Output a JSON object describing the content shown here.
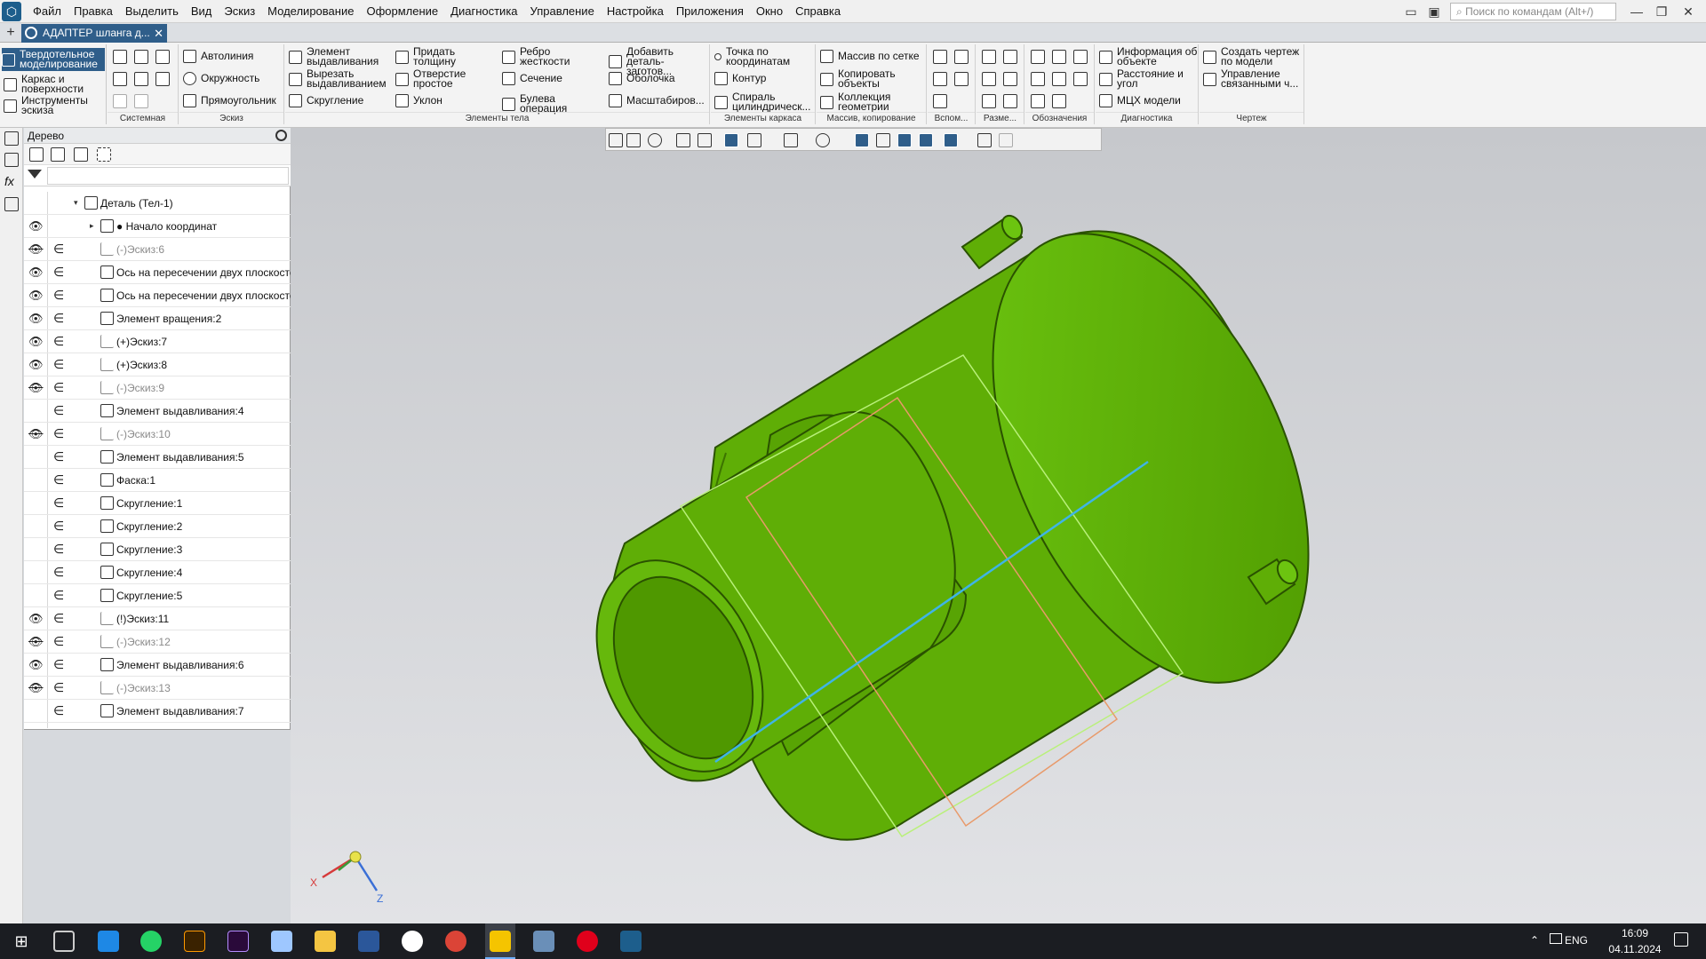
{
  "menubar": {
    "items": [
      "Файл",
      "Правка",
      "Выделить",
      "Вид",
      "Эскиз",
      "Моделирование",
      "Оформление",
      "Диагностика",
      "Управление",
      "Настройка",
      "Приложения",
      "Окно",
      "Справка"
    ],
    "search_placeholder": "Поиск по командам (Alt+/)"
  },
  "tabs": {
    "document_title": "АДАПТЕР шланга д..."
  },
  "ribbon": {
    "modes": [
      "Твердотельное моделирование",
      "Каркас и поверхности",
      "Инструменты эскиза"
    ],
    "groups": {
      "system": "Системная",
      "sketch": "Эскиз",
      "body": "Элементы тела",
      "frame": "Элементы каркаса",
      "array": "Массив, копирование",
      "aux": "Вспом...",
      "dims": "Разме...",
      "marks": "Обозначения",
      "diag": "Диагностика",
      "drawing": "Чертеж"
    },
    "sketch_tools": [
      "Автолиния",
      "Окружность",
      "Прямоугольник"
    ],
    "body_tools": [
      "Элемент выдавливания",
      "Вырезать выдавливанием",
      "Скругление",
      "Придать толщину",
      "Отверстие простое",
      "Уклон",
      "Ребро жесткости",
      "Сечение",
      "Булева операция",
      "Добавить деталь-заготов...",
      "Оболочка",
      "Масштабиров..."
    ],
    "frame_tools": [
      "Точка по координатам",
      "Контур",
      "Спираль цилиндрическ..."
    ],
    "array_tools": [
      "Массив по сетке",
      "Копировать объекты",
      "Коллекция геометрии"
    ],
    "diag_tools": [
      "Информация об объекте",
      "Расстояние и угол",
      "МЦХ модели"
    ],
    "drawing_tools": [
      "Создать чертеж по модели",
      "Управление связанными ч..."
    ]
  },
  "tree": {
    "title": "Дерево",
    "rows": [
      {
        "label": "Деталь (Тел-1)",
        "indent": 0,
        "eye": "",
        "dep": false,
        "dim": false,
        "expander": "▾"
      },
      {
        "label": "● Начало координат",
        "indent": 1,
        "eye": "on",
        "dep": false,
        "dim": false,
        "expander": "▸"
      },
      {
        "label": "(-)Эскиз:6",
        "indent": 1,
        "eye": "off",
        "dep": true,
        "dim": true,
        "expander": ""
      },
      {
        "label": "Ось на пересечении двух плоскостей",
        "indent": 1,
        "eye": "on",
        "dep": true,
        "dim": false,
        "expander": ""
      },
      {
        "label": "Ось на пересечении двух плоскостей",
        "indent": 1,
        "eye": "on",
        "dep": true,
        "dim": false,
        "expander": ""
      },
      {
        "label": "Элемент вращения:2",
        "indent": 1,
        "eye": "on",
        "dep": true,
        "dim": false,
        "expander": ""
      },
      {
        "label": "(+)Эскиз:7",
        "indent": 1,
        "eye": "on",
        "dep": true,
        "dim": false,
        "expander": ""
      },
      {
        "label": "(+)Эскиз:8",
        "indent": 1,
        "eye": "on",
        "dep": true,
        "dim": false,
        "expander": ""
      },
      {
        "label": "(-)Эскиз:9",
        "indent": 1,
        "eye": "off",
        "dep": true,
        "dim": true,
        "expander": ""
      },
      {
        "label": "Элемент выдавливания:4",
        "indent": 1,
        "eye": "",
        "dep": true,
        "dim": false,
        "expander": ""
      },
      {
        "label": "(-)Эскиз:10",
        "indent": 1,
        "eye": "off",
        "dep": true,
        "dim": true,
        "expander": ""
      },
      {
        "label": "Элемент выдавливания:5",
        "indent": 1,
        "eye": "",
        "dep": true,
        "dim": false,
        "expander": ""
      },
      {
        "label": "Фаска:1",
        "indent": 1,
        "eye": "",
        "dep": true,
        "dim": false,
        "expander": ""
      },
      {
        "label": "Скругление:1",
        "indent": 1,
        "eye": "",
        "dep": true,
        "dim": false,
        "expander": ""
      },
      {
        "label": "Скругление:2",
        "indent": 1,
        "eye": "",
        "dep": true,
        "dim": false,
        "expander": ""
      },
      {
        "label": "Скругление:3",
        "indent": 1,
        "eye": "",
        "dep": true,
        "dim": false,
        "expander": ""
      },
      {
        "label": "Скругление:4",
        "indent": 1,
        "eye": "",
        "dep": true,
        "dim": false,
        "expander": ""
      },
      {
        "label": "Скругление:5",
        "indent": 1,
        "eye": "",
        "dep": true,
        "dim": false,
        "expander": ""
      },
      {
        "label": "(!)Эскиз:11",
        "indent": 1,
        "eye": "on",
        "dep": true,
        "dim": false,
        "expander": ""
      },
      {
        "label": "(-)Эскиз:12",
        "indent": 1,
        "eye": "off",
        "dep": true,
        "dim": true,
        "expander": ""
      },
      {
        "label": "Элемент выдавливания:6",
        "indent": 1,
        "eye": "on",
        "dep": true,
        "dim": false,
        "expander": ""
      },
      {
        "label": "(-)Эскиз:13",
        "indent": 1,
        "eye": "off",
        "dep": true,
        "dim": true,
        "expander": ""
      },
      {
        "label": "Элемент выдавливания:7",
        "indent": 1,
        "eye": "",
        "dep": true,
        "dim": false,
        "expander": ""
      }
    ]
  },
  "viewport": {
    "axis_x": "X",
    "axis_z": "Z",
    "model_color": "#5fb800",
    "model_edge_color": "#2a5200"
  },
  "taskbar": {
    "lang": "ENG",
    "time": "16:09",
    "date": "04.11.2024"
  }
}
